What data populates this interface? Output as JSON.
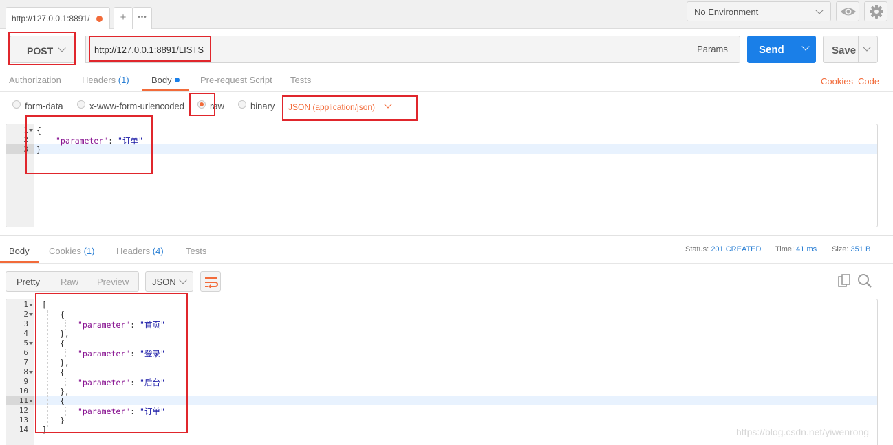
{
  "tabbar": {
    "tab_title": "http://127.0.0.1:8891/",
    "add_tab": "+",
    "more_tabs": "•••",
    "environment": "No Environment"
  },
  "request": {
    "method": "POST",
    "url": "http://127.0.0.1:8891/LISTS",
    "params_label": "Params",
    "send_label": "Send",
    "save_label": "Save"
  },
  "request_tabs": {
    "authorization": "Authorization",
    "headers": "Headers",
    "headers_count": "(1)",
    "body": "Body",
    "pre_request": "Pre-request Script",
    "tests": "Tests",
    "cookies": "Cookies",
    "code": "Code"
  },
  "body_modes": {
    "form_data": "form-data",
    "urlencoded": "x-www-form-urlencoded",
    "raw": "raw",
    "binary": "binary",
    "selected": "raw",
    "content_type": "JSON (application/json)"
  },
  "request_body": {
    "line_numbers": [
      "1",
      "2",
      "3"
    ],
    "open_brace": "{",
    "key": "\"parameter\"",
    "colon": ": ",
    "value": "\"订单\"",
    "close_brace": "}"
  },
  "response_tabs": {
    "body": "Body",
    "cookies": "Cookies",
    "cookies_count": "(1)",
    "headers": "Headers",
    "headers_count": "(4)",
    "tests": "Tests"
  },
  "response_status": {
    "status_label": "Status:",
    "status_value": "201 CREATED",
    "time_label": "Time:",
    "time_value": "41 ms",
    "size_label": "Size:",
    "size_value": "351 B"
  },
  "response_view": {
    "pretty": "Pretty",
    "raw": "Raw",
    "preview": "Preview",
    "format": "JSON"
  },
  "response_body": {
    "line_numbers": [
      "1",
      "2",
      "3",
      "4",
      "5",
      "6",
      "7",
      "8",
      "9",
      "10",
      "11",
      "12",
      "13",
      "14"
    ],
    "open_bracket": "[",
    "close_bracket": "]",
    "open_brace": "{",
    "close_brace_comma": "},",
    "close_brace": "}",
    "key": "\"parameter\"",
    "colon": ": ",
    "items": [
      "\"首页\"",
      "\"登录\"",
      "\"后台\"",
      "\"订单\""
    ]
  },
  "watermark": "https://blog.csdn.net/yiwenrong",
  "colors": {
    "accent": "#f26b3a",
    "send_blue": "#1a7fe8",
    "link_blue": "#2a7fd4",
    "annotation_red": "#e0262c"
  },
  "icons": [
    "plus-icon",
    "more-icon",
    "chevron-down-icon",
    "eye-icon",
    "gear-icon",
    "wrap-lines-icon",
    "copy-icon",
    "search-icon",
    "fold-arrow-icon"
  ]
}
